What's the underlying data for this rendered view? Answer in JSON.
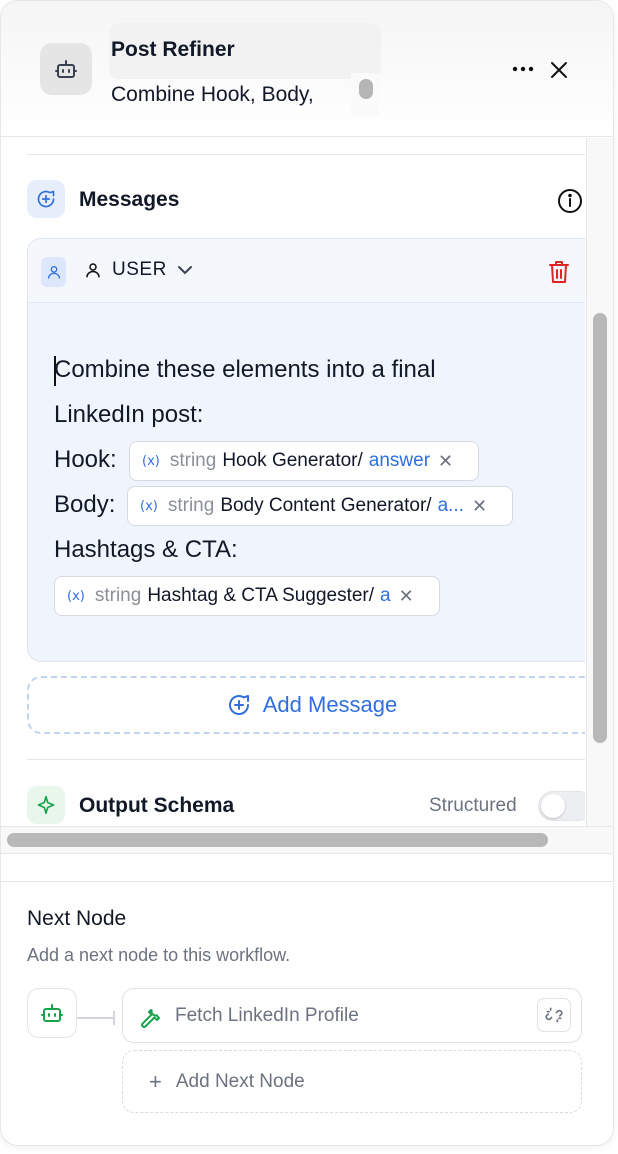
{
  "header": {
    "title": "Post Refiner",
    "description": "Combine Hook, Body,",
    "more_label": "•••"
  },
  "messages": {
    "section_title": "Messages",
    "items": [
      {
        "role": "USER",
        "lines": [
          "Combine these elements into a final",
          "LinkedIn post:",
          "Hook:",
          "Body:",
          "Hashtags & CTA:"
        ],
        "variables": [
          {
            "icon": "(x)",
            "type": "string",
            "node": "Hook Generator/",
            "field": "answer"
          },
          {
            "icon": "(x)",
            "type": "string",
            "node": "Body Content Generator/",
            "field": "a..."
          },
          {
            "icon": "(x)",
            "type": "string",
            "node": "Hashtag & CTA Suggester/",
            "field": "a"
          }
        ]
      }
    ],
    "add_label": "Add Message"
  },
  "output_schema": {
    "title": "Output Schema",
    "toggle_label": "Structured",
    "toggle_on": false
  },
  "next_node": {
    "title": "Next Node",
    "description": "Add a next node to this workflow.",
    "linked_node": "Fetch LinkedIn Profile",
    "add_label": "Add Next Node"
  },
  "colors": {
    "accent": "#2f6fe0",
    "danger": "#dc2626",
    "schema_icon": "#16a34a"
  }
}
